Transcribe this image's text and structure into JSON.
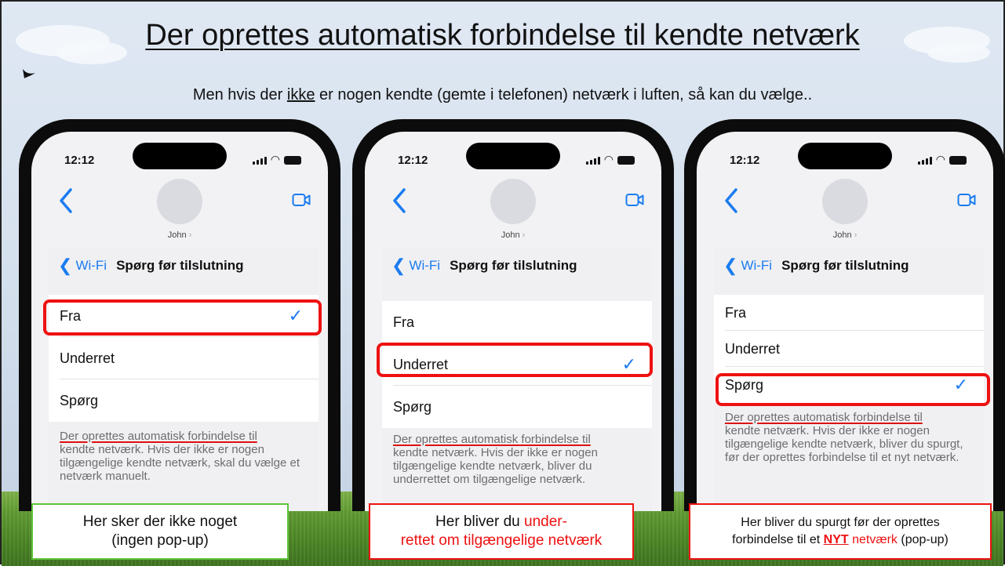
{
  "title": "Der oprettes automatisk forbindelse til kendte netværk",
  "subtitle": {
    "before": "Men hvis der ",
    "underlined": "ikke",
    "after": " er nogen kendte (gemte i telefonen) netværk i luften, så kan du vælge.."
  },
  "phones": [
    {
      "time": "12:12",
      "contact": "John",
      "nav_back": "Wi-Fi",
      "nav_title": "Spørg før tilslutning",
      "options": [
        "Fra",
        "Underret",
        "Spørg"
      ],
      "selected": "Fra",
      "description_first": "Der oprettes automatisk forbindelse til",
      "description_rest": "kendte netværk. Hvis der ikke er nogen tilgængelige kendte netværk, skal du vælge et netværk manuelt."
    },
    {
      "time": "12:12",
      "contact": "John",
      "nav_back": "Wi-Fi",
      "nav_title": "Spørg før tilslutning",
      "options": [
        "Fra",
        "Underret",
        "Spørg"
      ],
      "selected": "Underret",
      "description_first": "Der oprettes automatisk forbindelse til",
      "description_rest": "kendte netværk. Hvis der ikke er nogen tilgængelige kendte netværk, bliver du underrettet om tilgængelige netværk."
    },
    {
      "time": "12:12",
      "contact": "John",
      "nav_back": "Wi-Fi",
      "nav_title": "Spørg før tilslutning",
      "options": [
        "Fra",
        "Underret",
        "Spørg"
      ],
      "selected": "Spørg",
      "description_first": "Der oprettes automatisk forbindelse til",
      "description_rest": "kendte netværk. Hvis der ikke er nogen tilgængelige kendte netværk, bliver du spurgt, før der oprettes forbindelse til et nyt netværk."
    }
  ],
  "captions": {
    "c1_line1": "Her sker der ikke noget",
    "c1_line2": "(ingen pop-up)",
    "c2_before": "Her bliver du ",
    "c2_red1": "under-",
    "c2_red2": "rettet om tilgængelige netværk",
    "c3_line1": "Her bliver du spurgt før der oprettes",
    "c3_before": "forbindelse til et ",
    "c3_nyt": "NYT",
    "c3_red": " netværk",
    "c3_after": " (pop-up)"
  },
  "icons": {
    "back": "chevron-left-icon",
    "video": "video-camera-icon",
    "check": "checkmark-icon"
  },
  "colors": {
    "ios_blue": "#1b7cf0",
    "highlight_red": "#e11",
    "caption_green": "#5ec43a"
  }
}
